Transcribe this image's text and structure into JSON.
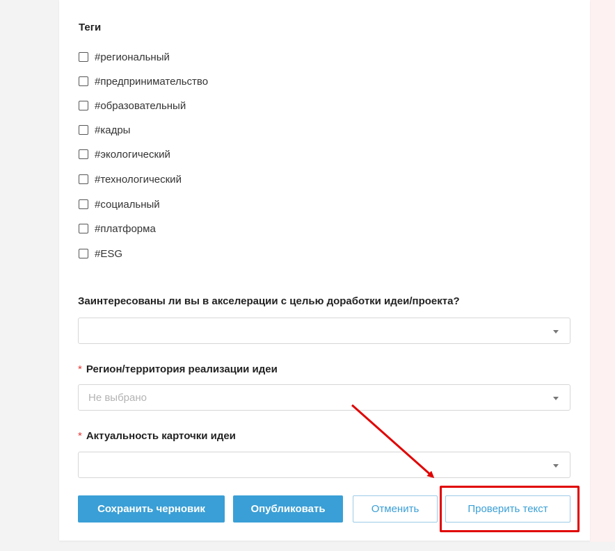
{
  "tags": {
    "title": "Теги",
    "items": [
      "#региональный",
      "#предпринимательство",
      "#образовательный",
      "#кадры",
      "#экологический",
      "#технологический",
      "#социальный",
      "#платформа",
      "#ESG"
    ]
  },
  "acceleration": {
    "label": "Заинтересованы ли вы в акселерации с целью доработки идеи/проекта?",
    "value": ""
  },
  "region": {
    "required_mark": "*",
    "label": "Регион/территория реализации идеи",
    "placeholder": "Не выбрано"
  },
  "relevance": {
    "required_mark": "*",
    "label": "Актуальность карточки идеи",
    "value": ""
  },
  "buttons": {
    "save_draft": "Сохранить черновик",
    "publish": "Опубликовать",
    "cancel": "Отменить",
    "check_text": "Проверить текст"
  },
  "colors": {
    "primary": "#3a9fd6",
    "annotation": "#e00000",
    "required": "#e53935"
  }
}
